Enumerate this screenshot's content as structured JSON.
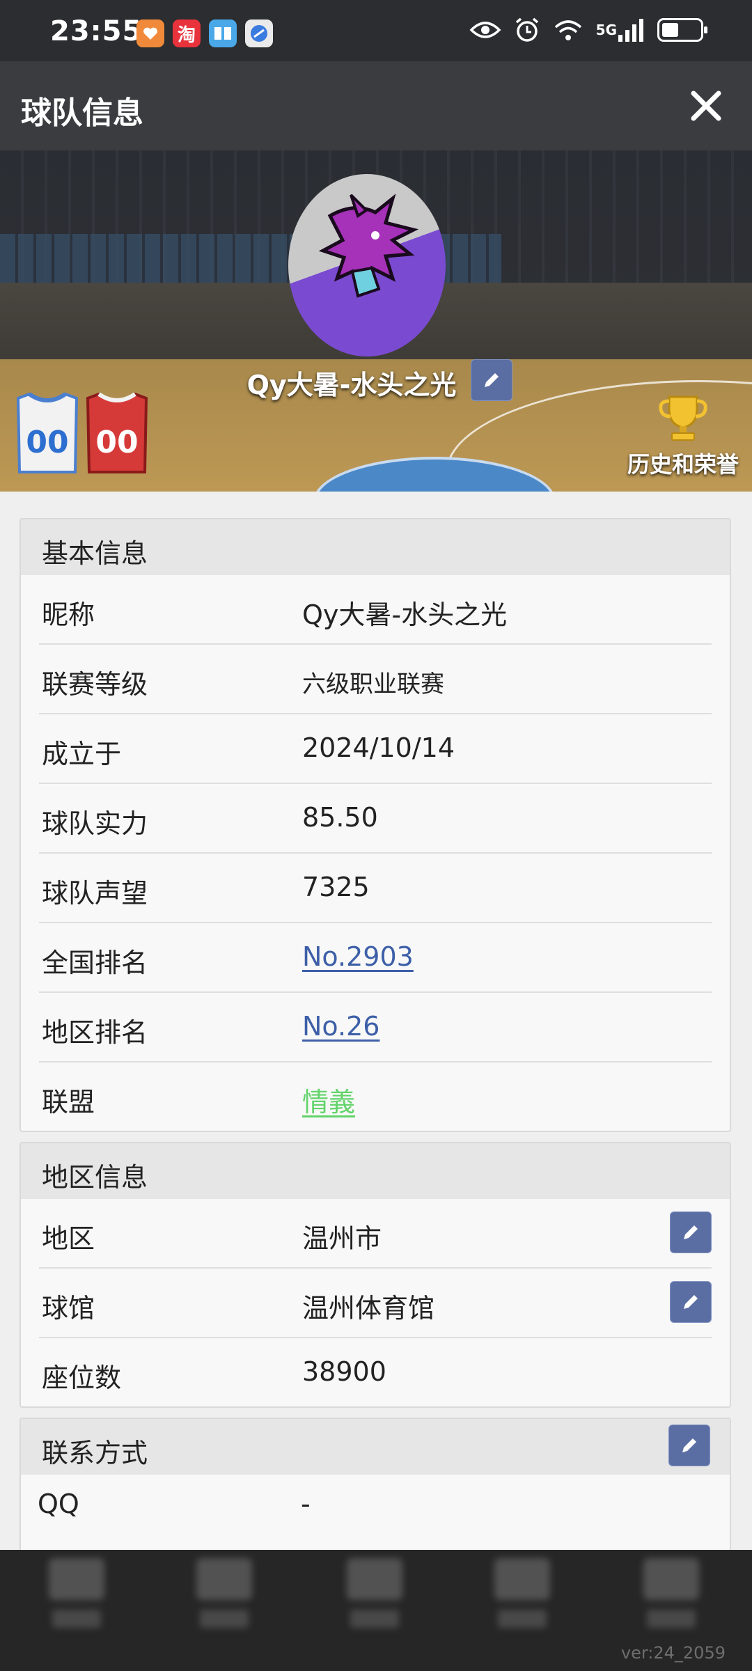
{
  "status_bar": {
    "time": "23:55",
    "network": "5G",
    "battery_level": 0.45,
    "app_icons": [
      "heart-app-icon",
      "taobao-icon",
      "book-app-icon",
      "browser-app-icon"
    ],
    "taobao_glyph": "淘"
  },
  "header": {
    "title": "球队信息",
    "close_icon": "close-icon"
  },
  "banner": {
    "team_name": "Qy大暑-水头之光",
    "jersey_home_number": "00",
    "jersey_away_number": "00",
    "honors_label": "历史和荣誉"
  },
  "basic_info": {
    "title": "基本信息",
    "rows": [
      {
        "label": "昵称",
        "value": "Qy大暑-水头之光"
      },
      {
        "label": "联赛等级",
        "value": "六级职业联赛"
      },
      {
        "label": "成立于",
        "value": "2024/10/14"
      },
      {
        "label": "球队实力",
        "value": "85.50"
      },
      {
        "label": "球队声望",
        "value": "7325"
      },
      {
        "label": "全国排名",
        "value": "No.2903"
      },
      {
        "label": "地区排名",
        "value": "No.26"
      },
      {
        "label": "联盟",
        "value": "情義"
      }
    ]
  },
  "region_info": {
    "title": "地区信息",
    "rows": [
      {
        "label": "地区",
        "value": "温州市"
      },
      {
        "label": "球馆",
        "value": "温州体育馆"
      },
      {
        "label": "座位数",
        "value": "38900"
      }
    ]
  },
  "contact": {
    "title": "联系方式",
    "rows": [
      {
        "label": "QQ",
        "value": "-"
      }
    ]
  },
  "footer": {
    "version": "ver:24_2059"
  },
  "colors": {
    "link": "#3d5fa8",
    "alliance": "#62d46a",
    "edit_button": "#5b6ea4",
    "header_bg": "#3a3c40"
  }
}
